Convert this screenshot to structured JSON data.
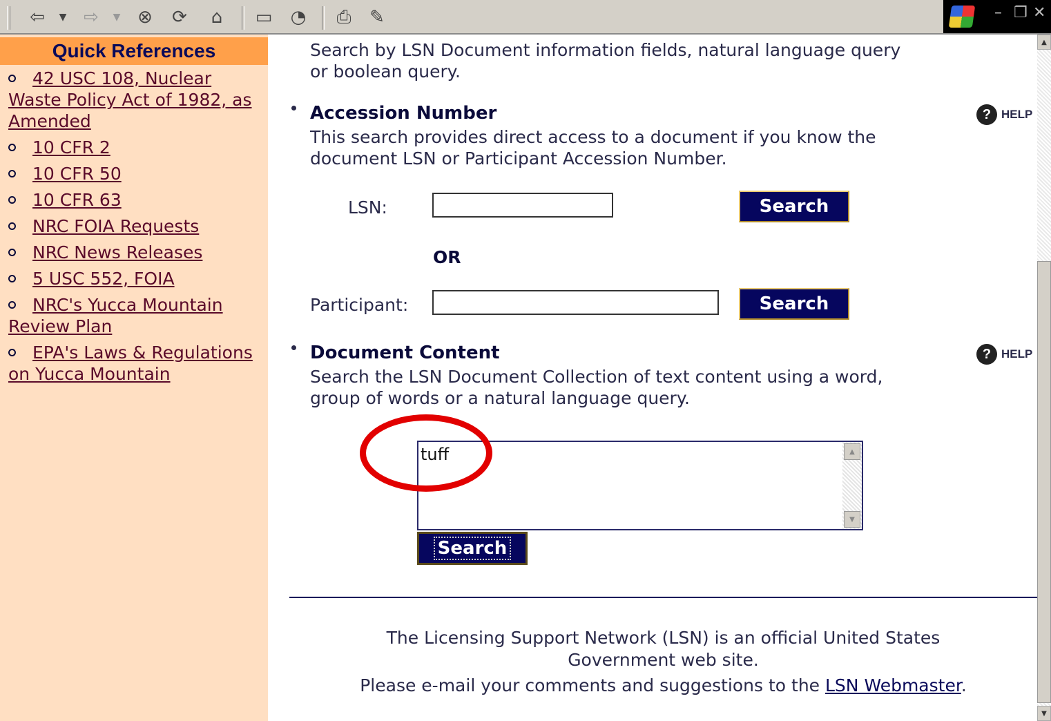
{
  "toolbar": {
    "icons": [
      "back-arrow-icon",
      "forward-arrow-icon",
      "stop-icon",
      "refresh-icon",
      "home-icon",
      "favorites-folder-icon",
      "history-icon",
      "print-icon",
      "edit-icon"
    ],
    "window_controls": [
      "minimize",
      "restore",
      "close"
    ]
  },
  "sidebar": {
    "title": "Quick References",
    "links": [
      "42 USC 108, Nuclear Waste Policy Act of 1982, as Amended",
      "10 CFR 2",
      "10 CFR 50",
      "10 CFR 63",
      "NRC FOIA Requests",
      "NRC News Releases",
      "5 USC 552, FOIA",
      "NRC's Yucca Mountain Review Plan",
      "EPA's Laws & Regulations on Yucca Mountain"
    ]
  },
  "main": {
    "intro_line1": "Search by LSN Document information fields, natural language query",
    "intro_line2": "or boolean query.",
    "accession": {
      "title": "Accession Number",
      "help": "HELP",
      "desc_line1": "This search provides direct access to a document if you know the",
      "desc_line2": "document LSN or Participant Accession Number.",
      "lsn_label": "LSN:",
      "lsn_value": "",
      "or_label": "OR",
      "participant_label": "Participant:",
      "participant_value": "",
      "search_button": "Search"
    },
    "content": {
      "title": "Document Content",
      "help": "HELP",
      "desc_line1": "Search the LSN Document Collection of text content using a word,",
      "desc_line2": "group of words or a natural language query.",
      "query_value": "tuff",
      "search_button": "Search"
    },
    "footer": {
      "line1": "The Licensing Support Network (LSN) is an official United States",
      "line1b": "Government web site.",
      "line2_prefix": "Please e-mail your comments and suggestions to the",
      "line2_link": "LSN Webmaster",
      "line2_suffix": "."
    }
  },
  "colors": {
    "sidebar_bg": "#ffdfc2",
    "sidebar_header": "#ffa04a",
    "button_bg": "#06065e",
    "annotation_circle": "#e20000"
  }
}
